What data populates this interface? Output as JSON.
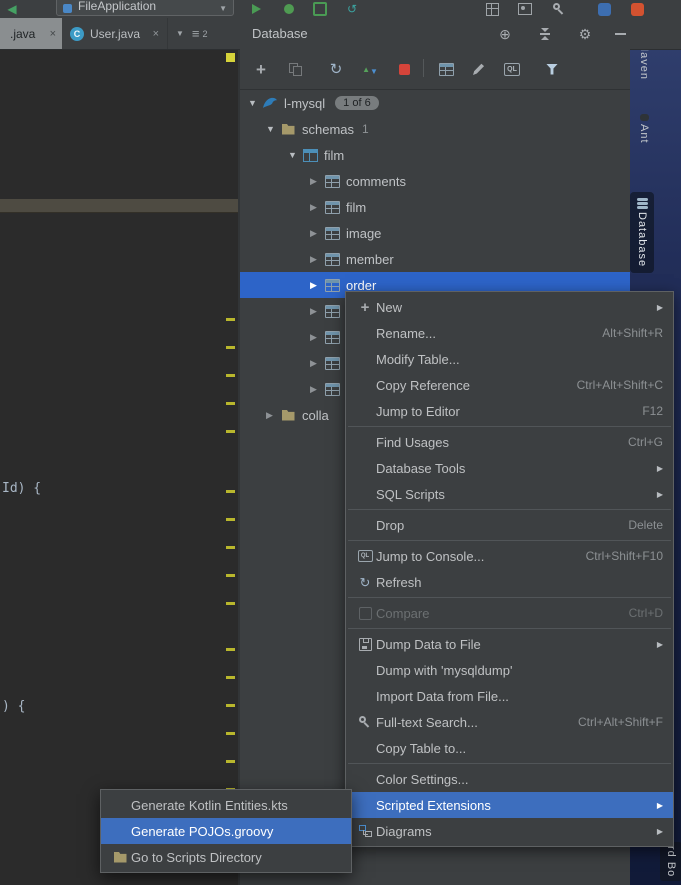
{
  "colors": {
    "panel_bg": "#3C3F41",
    "editor_bg": "#2B2B2B",
    "menu_selection_blue": "#3D6EBE",
    "tree_selection_blue": "#2D64C8",
    "stop_red": "#D5443A",
    "warning_stripe_yellow": "#B9B72D",
    "desktop_blue": "#222E59"
  },
  "top_toolbar": {
    "run_config_label": "FileApplication",
    "icons": [
      "back-icon",
      "run-icon",
      "debug-icon",
      "coverage-icon",
      "update-icon",
      "grid-icon",
      "image-icon",
      "search-icon",
      "app-blue-icon",
      "app-orange-icon"
    ]
  },
  "editor_tabs": {
    "tab1": {
      "label": ".java"
    },
    "tab2": {
      "label": "User.java",
      "icon": "class-icon",
      "icon_letter": "C"
    },
    "hidden_tabs_count": "2"
  },
  "database_panel": {
    "title": "Database",
    "header_icons": [
      "globe-icon",
      "collapse-icon",
      "settings-gear-icon",
      "hide-icon"
    ],
    "toolbar_icons": [
      "add-icon",
      "copy-icon",
      "refresh-icon",
      "sync-icon",
      "stop-icon",
      "table-icon",
      "edit-icon",
      "console-icon",
      "filter-icon"
    ],
    "console_icon_text": "QL",
    "tree": {
      "root_label": "l-mysql",
      "root_badge": "1 of 6",
      "schemas_label": "schemas",
      "schemas_count": "1",
      "schema_label": "film",
      "tables": [
        "comments",
        "film",
        "image",
        "member",
        "order"
      ],
      "selected_table": "order",
      "collapsed_folder_label": "colla"
    }
  },
  "context_menu": {
    "items": [
      {
        "label": "New",
        "icon": "plus-icon",
        "has_submenu": true
      },
      {
        "label": "Rename...",
        "shortcut": "Alt+Shift+R"
      },
      {
        "label": "Modify Table..."
      },
      {
        "label": "Copy Reference",
        "shortcut": "Ctrl+Alt+Shift+C"
      },
      {
        "label": "Jump to Editor",
        "shortcut": "F12"
      },
      {
        "label": "Find Usages",
        "shortcut": "Ctrl+G"
      },
      {
        "label": "Database Tools",
        "has_submenu": true
      },
      {
        "label": "SQL Scripts",
        "has_submenu": true
      },
      {
        "label": "Drop",
        "shortcut": "Delete"
      },
      {
        "label": "Jump to Console...",
        "icon": "console-icon",
        "shortcut": "Ctrl+Shift+F10"
      },
      {
        "label": "Refresh",
        "icon": "refresh-icon"
      },
      {
        "label": "Compare",
        "icon": "compare-icon",
        "shortcut": "Ctrl+D",
        "disabled": true
      },
      {
        "label": "Dump Data to File",
        "icon": "save-icon",
        "has_submenu": true
      },
      {
        "label": "Dump with 'mysqldump'"
      },
      {
        "label": "Import Data from File..."
      },
      {
        "label": "Full-text Search...",
        "icon": "search-icon",
        "shortcut": "Ctrl+Alt+Shift+F"
      },
      {
        "label": "Copy Table to..."
      },
      {
        "label": "Color Settings..."
      },
      {
        "label": "Scripted Extensions",
        "has_submenu": true,
        "selected": true
      },
      {
        "label": "Diagrams",
        "icon": "diagram-icon",
        "has_submenu": true
      }
    ]
  },
  "submenu": {
    "items": [
      {
        "label": "Generate Kotlin Entities.kts"
      },
      {
        "label": "Generate POJOs.groovy",
        "selected": true
      },
      {
        "label": "Go to Scripts Directory",
        "icon": "folder-icon"
      }
    ]
  },
  "right_toolbar": {
    "maven_icon": "m",
    "maven_label": "Maven",
    "ant_label": "Ant",
    "database_label": "Database",
    "bottom_label": "rd Bo"
  },
  "editor": {
    "code_line_1": "Id) {",
    "code_line_2": ") {"
  }
}
